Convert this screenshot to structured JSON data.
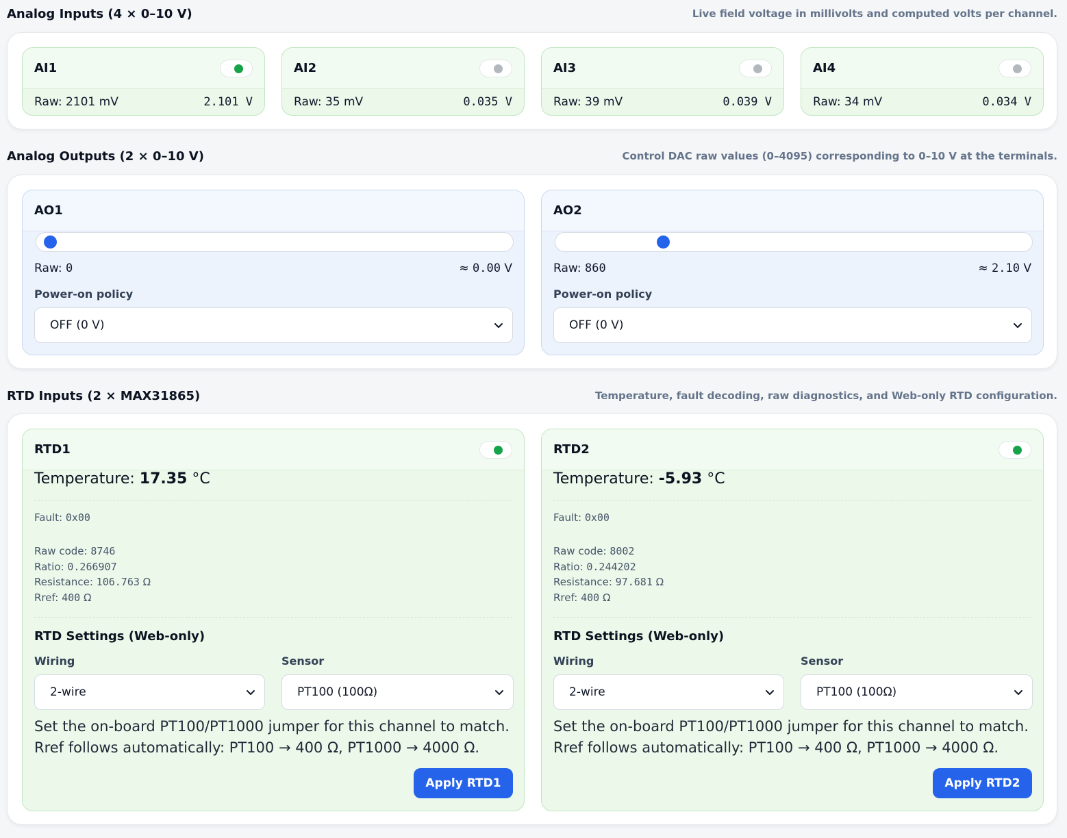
{
  "analog_inputs": {
    "title": "Analog Inputs (4 × 0–10 V)",
    "description": "Live field voltage in millivolts and computed volts per channel.",
    "channels": [
      {
        "name": "AI1",
        "raw": "Raw: 2101 mV",
        "volts": "2.101 V",
        "active": true
      },
      {
        "name": "AI2",
        "raw": "Raw: 35 mV",
        "volts": "0.035 V",
        "active": false
      },
      {
        "name": "AI3",
        "raw": "Raw: 39 mV",
        "volts": "0.039 V",
        "active": false
      },
      {
        "name": "AI4",
        "raw": "Raw: 34 mV",
        "volts": "0.034 V",
        "active": false
      }
    ]
  },
  "analog_outputs": {
    "title": "Analog Outputs (2 × 0–10 V)",
    "description": "Control DAC raw values (0–4095) corresponding to 0–10 V at the terminals.",
    "slider_max": 4095,
    "channels": [
      {
        "name": "AO1",
        "raw_label": "Raw:",
        "raw_value": 0,
        "volts_prefix": "≈",
        "volts": "0.00",
        "volts_unit": "V",
        "policy_label": "Power-on policy",
        "policy": "OFF (0 V)"
      },
      {
        "name": "AO2",
        "raw_label": "Raw:",
        "raw_value": 860,
        "volts_prefix": "≈",
        "volts": "2.10",
        "volts_unit": "V",
        "policy_label": "Power-on policy",
        "policy": "OFF (0 V)"
      }
    ]
  },
  "rtd_inputs": {
    "title": "RTD Inputs (2 × MAX31865)",
    "description": "Temperature, fault decoding, raw diagnostics, and Web-only RTD configuration.",
    "channels": [
      {
        "name": "RTD1",
        "active": true,
        "temp_label": "Temperature:",
        "temp_value": "17.35",
        "temp_unit": "°C",
        "fault_label": "Fault:",
        "fault_value": "0x00",
        "raw_code_label": "Raw code:",
        "raw_code_value": "8746",
        "ratio_label": "Ratio:",
        "ratio_value": "0.266907",
        "resistance_label": "Resistance:",
        "resistance_value": "106.763",
        "resistance_unit": "Ω",
        "rref_label": "Rref:",
        "rref_value": "400",
        "rref_unit": "Ω",
        "settings_title": "RTD Settings (Web-only)",
        "wiring_label": "Wiring",
        "wiring_value": "2-wire",
        "sensor_label": "Sensor",
        "sensor_value": "PT100 (100Ω)",
        "note_line1": "Set the on-board PT100/PT1000 jumper for this channel to match.",
        "note_line2": "Rref follows automatically: PT100 → 400 Ω, PT1000 → 4000 Ω.",
        "apply_label": "Apply RTD1"
      },
      {
        "name": "RTD2",
        "active": true,
        "temp_label": "Temperature:",
        "temp_value": "-5.93",
        "temp_unit": "°C",
        "fault_label": "Fault:",
        "fault_value": "0x00",
        "raw_code_label": "Raw code:",
        "raw_code_value": "8002",
        "ratio_label": "Ratio:",
        "ratio_value": "0.244202",
        "resistance_label": "Resistance:",
        "resistance_value": "97.681",
        "resistance_unit": "Ω",
        "rref_label": "Rref:",
        "rref_value": "400",
        "rref_unit": "Ω",
        "settings_title": "RTD Settings (Web-only)",
        "wiring_label": "Wiring",
        "wiring_value": "2-wire",
        "sensor_label": "Sensor",
        "sensor_value": "PT100 (100Ω)",
        "note_line1": "Set the on-board PT100/PT1000 jumper for this channel to match.",
        "note_line2": "Rref follows automatically: PT100 → 400 Ω, PT1000 → 4000 Ω.",
        "apply_label": "Apply RTD2"
      }
    ]
  },
  "colors": {
    "accent": "#2563eb",
    "status_on": "#16a34a",
    "status_off": "#b3b8bf",
    "input_card_bg": "#ebf8ea",
    "output_card_bg": "#edf3fd"
  }
}
